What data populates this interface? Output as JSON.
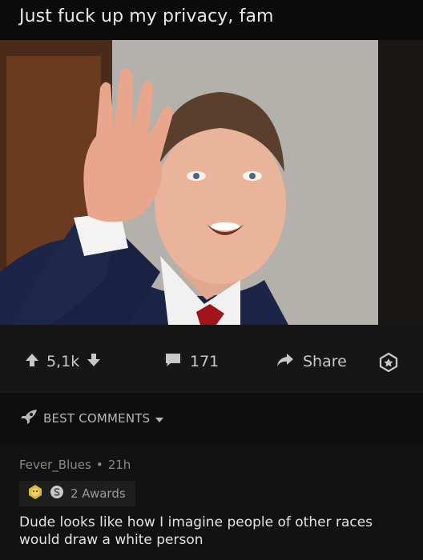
{
  "post": {
    "title": "Just fuck up my privacy, fam"
  },
  "actions": {
    "vote_count": "5,1k",
    "comment_count": "171",
    "share_label": "Share"
  },
  "sort": {
    "label": "BEST COMMENTS"
  },
  "comment": {
    "author": "Fever_Blues",
    "separator": "•",
    "age": "21h",
    "awards_label": "2 Awards",
    "body": "Dude looks like how I imagine people of other races would draw a white person"
  },
  "icons": {
    "upvote": "arrow-up-icon",
    "downvote": "arrow-down-icon",
    "comment": "speech-bubble-icon",
    "share": "share-arrow-icon",
    "award": "award-icon",
    "sort": "rocket-icon"
  },
  "colors": {
    "background": "#0b0b0b",
    "bar": "#161616",
    "text": "#d7dadc",
    "muted": "#8a8a8a"
  }
}
